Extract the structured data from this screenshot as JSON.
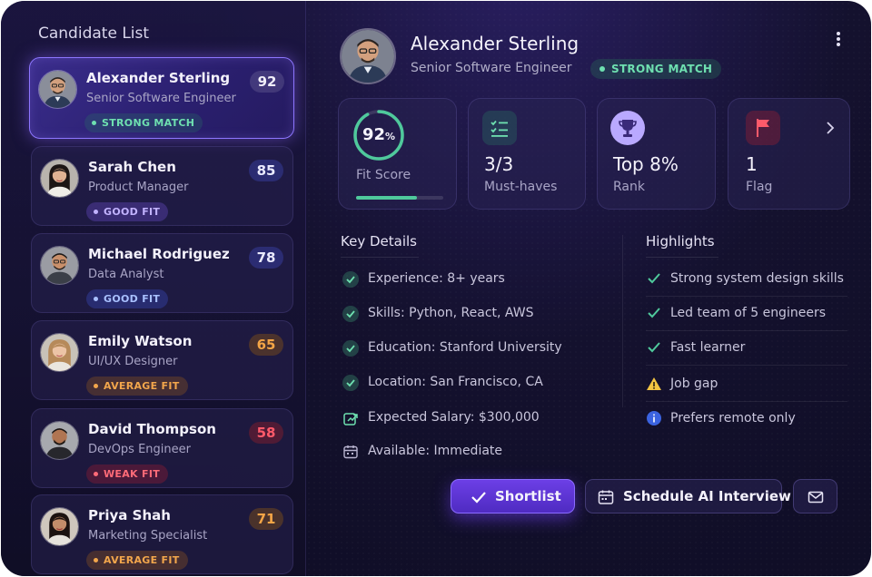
{
  "sidebar": {
    "title": "Candidate List",
    "candidates": [
      {
        "name": "Alexander Sterling",
        "role": "Senior Software Engineer",
        "score": "92",
        "badge": "STRONG MATCH",
        "badge_color": "#6ee0b0",
        "active": true
      },
      {
        "name": "Sarah Chen",
        "role": "Product Manager",
        "score": "85",
        "badge": "GOOD FIT",
        "badge_color": "#c2b3ff"
      },
      {
        "name": "Michael Rodriguez",
        "role": "Data Analyst",
        "score": "78",
        "badge": "GOOD FIT",
        "badge_color": "#a9c0ff"
      },
      {
        "name": "Emily Watson",
        "role": "UI/UX Designer",
        "score": "65",
        "badge": "AVERAGE FIT",
        "badge_color": "#f2a64c"
      },
      {
        "name": "David Thompson",
        "role": "DevOps Engineer",
        "score": "58",
        "badge": "WEAK FIT",
        "badge_color": "#ff6b78"
      },
      {
        "name": "Priya Shah",
        "role": "Marketing Specialist",
        "score": "71",
        "badge": "AVERAGE FIT",
        "badge_color": "#f2a64c"
      }
    ]
  },
  "profile": {
    "name": "Alexander Sterling",
    "role": "Senior Software Engineer",
    "badge": "STRONG MATCH",
    "menu_icon": "more-vertical-icon"
  },
  "stats": {
    "fit": {
      "value": "92",
      "unit": "%",
      "label": "Fit Score",
      "fraction": 0.92,
      "bar_fraction": 0.7
    },
    "must_haves": {
      "value": "3/3",
      "label": "Must-haves",
      "icon": "checklist-icon"
    },
    "rank": {
      "value": "Top 8%",
      "label": "Rank",
      "icon": "trophy-icon"
    },
    "flag": {
      "value": "1",
      "label": "Flag",
      "icon": "flag-icon"
    },
    "next_icon": "chevron-right-icon"
  },
  "key_details": {
    "title": "Key Details",
    "items": [
      {
        "text": "Experience: 8+ years",
        "icon": "check-circle-icon"
      },
      {
        "text": "Skills: Python, React, AWS",
        "icon": "check-circle-icon"
      },
      {
        "text": "Education: Stanford University",
        "icon": "check-circle-icon"
      },
      {
        "text": "Location: San Francisco, CA",
        "icon": "check-circle-icon"
      },
      {
        "text": "Expected Salary: $300,000",
        "icon": "salary-icon"
      },
      {
        "text": "Available: Immediate",
        "icon": "calendar-icon"
      }
    ]
  },
  "highlights": {
    "title": "Highlights",
    "items": [
      {
        "text": "Strong system design skills",
        "icon": "check-icon"
      },
      {
        "text": "Led team of 5 engineers",
        "icon": "check-icon"
      },
      {
        "text": "Fast learner",
        "icon": "check-icon"
      },
      {
        "text": "Job gap",
        "icon": "warning-icon"
      },
      {
        "text": "Prefers remote only",
        "icon": "info-icon"
      }
    ]
  },
  "actions": {
    "shortlist": "Shortlist",
    "schedule": "Schedule AI Interview",
    "mail_icon": "mail-icon"
  },
  "colors": {
    "accent": "#6c3fe6",
    "success": "#4fc99c",
    "warning": "#f4c542",
    "info": "#3b63e0",
    "danger": "#ff5a6a"
  }
}
